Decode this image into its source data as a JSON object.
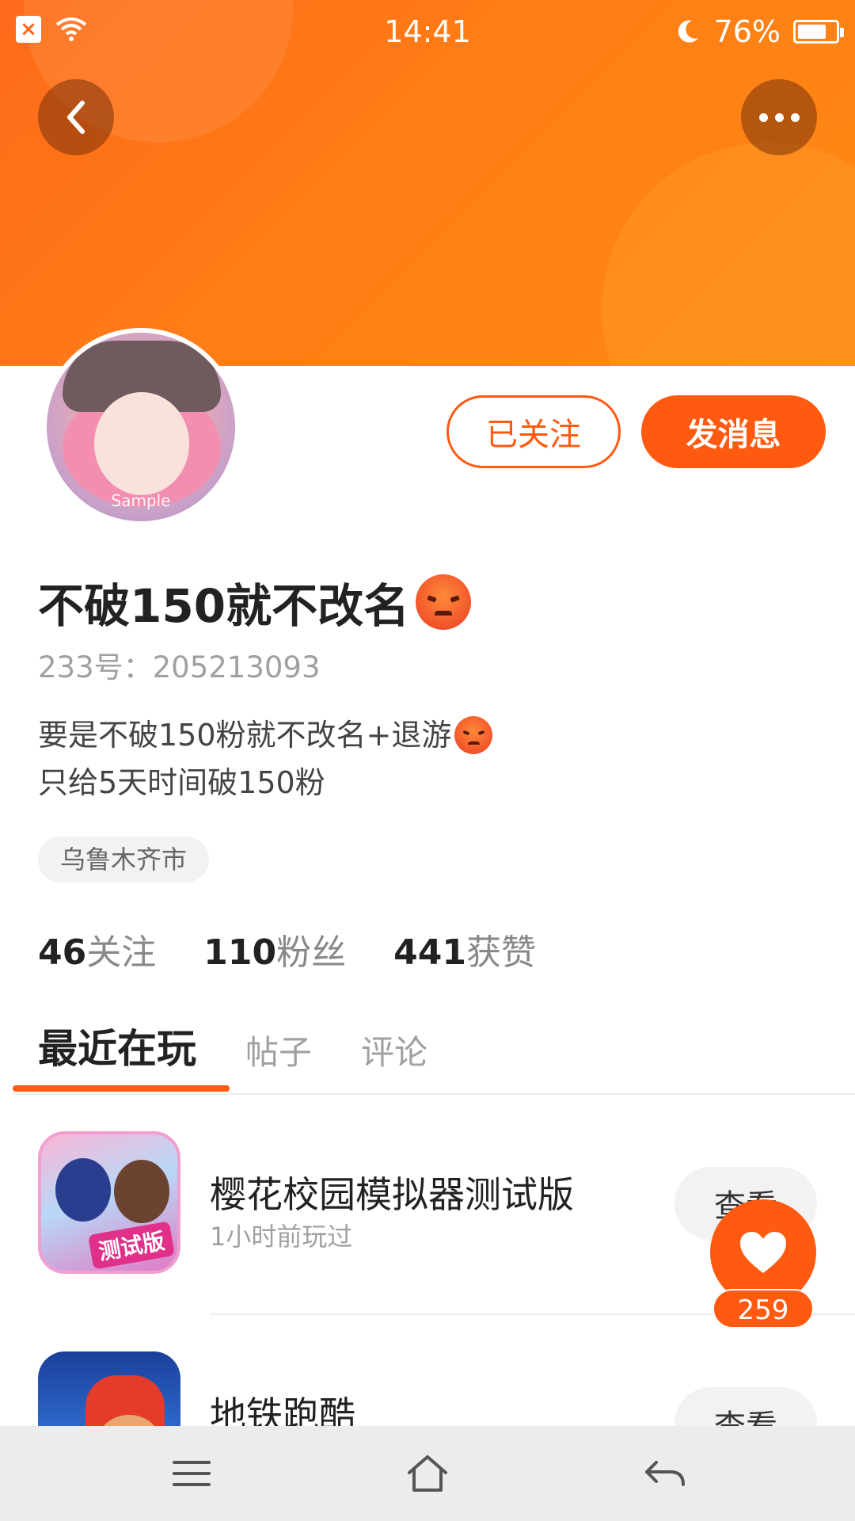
{
  "status_bar": {
    "time": "14:41",
    "battery": "76%",
    "battery_level": 0.76
  },
  "header": {
    "back_icon": "chevron-left-icon",
    "more_icon": "more-dots-icon",
    "colors": {
      "banner": "#ff7a18",
      "accent": "#ff5a10"
    }
  },
  "profile": {
    "avatar_watermark": "Sample",
    "follow_label": "已关注",
    "message_label": "发消息",
    "name": "不破150就不改名",
    "uid": "233号：205213093",
    "bio_line1": "要是不破150粉就不改名+退游",
    "bio_line2": "只给5天时间破150粉",
    "location": "乌鲁木齐市"
  },
  "stats": [
    {
      "num": "46",
      "label": "关注"
    },
    {
      "num": "110",
      "label": "粉丝"
    },
    {
      "num": "441",
      "label": "获赞"
    }
  ],
  "tabs": [
    {
      "label": "最近在玩",
      "active": true
    },
    {
      "label": "帖子",
      "active": false
    },
    {
      "label": "评论",
      "active": false
    }
  ],
  "games": [
    {
      "title": "樱花校园模拟器测试版",
      "subtitle": "1小时前玩过",
      "icon_tag": "测试版",
      "view_label": "查看"
    },
    {
      "title": "地铁跑酷",
      "subtitle": "",
      "view_label": "查看"
    }
  ],
  "like": {
    "count": "259"
  }
}
